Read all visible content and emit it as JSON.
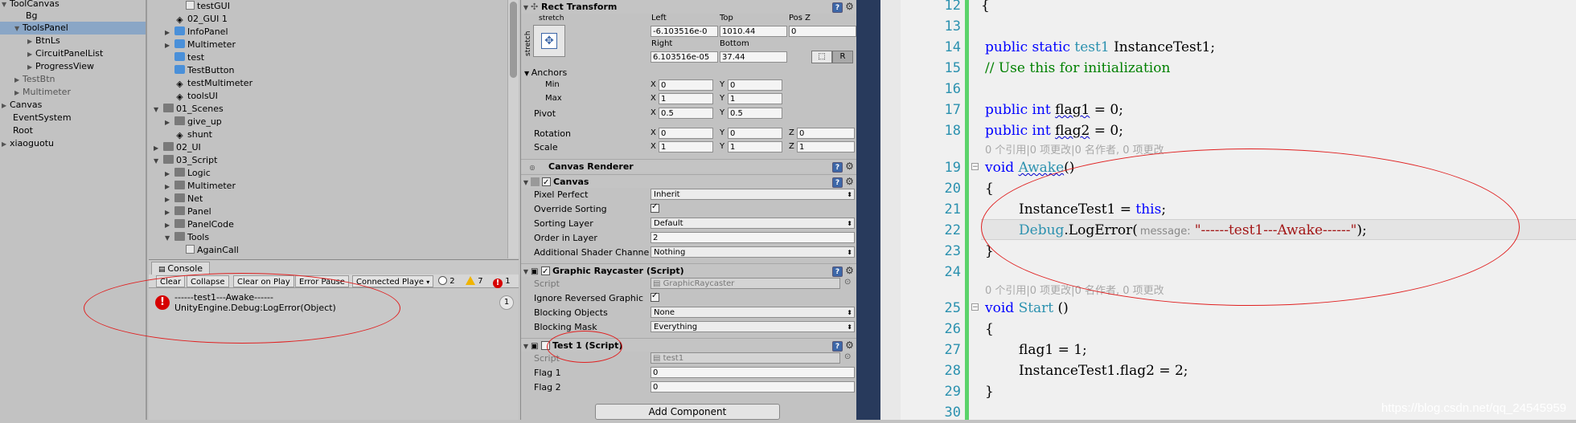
{
  "hierarchy": {
    "items": [
      {
        "label": "ToolCanvas",
        "expanded": "▼"
      },
      {
        "label": "Bg"
      },
      {
        "label": "ToolsPanel",
        "expanded": "▼"
      },
      {
        "label": "BtnLs",
        "expanded": "▶"
      },
      {
        "label": "CircuitPanelList",
        "expanded": "▶"
      },
      {
        "label": "ProgressView",
        "expanded": "▶"
      },
      {
        "label": "TestBtn",
        "expanded": "▶"
      },
      {
        "label": "Multimeter",
        "expanded": "▶"
      },
      {
        "label": "Canvas",
        "expanded": "▶"
      },
      {
        "label": "EventSystem"
      },
      {
        "label": "Root"
      },
      {
        "label": "xiaoguotu",
        "expanded": "▶"
      }
    ]
  },
  "project": {
    "items": [
      {
        "label": "testGUI"
      },
      {
        "label": "02_GUI 1"
      },
      {
        "label": "InfoPanel",
        "expanded": "▶"
      },
      {
        "label": "Multimeter",
        "expanded": "▶"
      },
      {
        "label": "test"
      },
      {
        "label": "TestButton"
      },
      {
        "label": "testMultimeter"
      },
      {
        "label": "toolsUI"
      },
      {
        "label": "01_Scenes",
        "expanded": "▼"
      },
      {
        "label": "give_up",
        "expanded": "▶"
      },
      {
        "label": "shunt"
      },
      {
        "label": "02_UI",
        "expanded": "▶"
      },
      {
        "label": "03_Script",
        "expanded": "▼"
      },
      {
        "label": "Logic",
        "expanded": "▶"
      },
      {
        "label": "Multimeter",
        "expanded": "▶"
      },
      {
        "label": "Net",
        "expanded": "▶"
      },
      {
        "label": "Panel",
        "expanded": "▶"
      },
      {
        "label": "PanelCode",
        "expanded": "▶"
      },
      {
        "label": "Tools",
        "expanded": "▼"
      },
      {
        "label": "AgainCall"
      }
    ]
  },
  "console": {
    "tab": "Console",
    "buttons": {
      "clear": "Clear",
      "collapse": "Collapse",
      "clear_on_play": "Clear on Play",
      "error_pause": "Error Pause",
      "connected": "Connected Playe"
    },
    "counts": {
      "info": "2",
      "warn": "7",
      "error": "1"
    },
    "entry": {
      "line1": "------test1---Awake------",
      "line2": "UnityEngine.Debug:LogError(Object)",
      "count": "1"
    }
  },
  "inspector": {
    "rect": {
      "title": "Rect Transform",
      "stretch_top": "stretch",
      "stretch_side": "stretch",
      "hdr_left": "Left",
      "hdr_top": "Top",
      "hdr_posz": "Pos Z",
      "left": "-6.103516e-0",
      "top": "1010.44",
      "posz": "0",
      "hdr_right": "Right",
      "hdr_bottom": "Bottom",
      "right": "6.103516e-05",
      "bottom": "37.44",
      "r_label": "R",
      "anchors": "Anchors",
      "min": "Min",
      "max": "Max",
      "min_x": "0",
      "min_y": "0",
      "max_x": "1",
      "max_y": "1",
      "pivot": "Pivot",
      "pivot_x": "0.5",
      "pivot_y": "0.5",
      "rotation": "Rotation",
      "rot_x": "0",
      "rot_y": "0",
      "rot_z": "0",
      "scale": "Scale",
      "scale_x": "1",
      "scale_y": "1",
      "scale_z": "1",
      "ax_x": "X",
      "ax_y": "Y",
      "ax_z": "Z"
    },
    "canvas_renderer": "Canvas Renderer",
    "canvas": {
      "title": "Canvas",
      "pixel_perfect": "Pixel Perfect",
      "pixel_perfect_val": "Inherit",
      "override_sorting": "Override Sorting",
      "sorting_layer": "Sorting Layer",
      "sorting_layer_val": "Default",
      "order_in_layer": "Order in Layer",
      "order_val": "2",
      "shader_channels": "Additional Shader Channe",
      "shader_val": "Nothing"
    },
    "raycaster": {
      "title": "Graphic Raycaster (Script)",
      "script": "Script",
      "script_val": "GraphicRaycaster",
      "ignore": "Ignore Reversed Graphic",
      "blocking_objects": "Blocking Objects",
      "blocking_objects_val": "None",
      "blocking_mask": "Blocking Mask",
      "blocking_mask_val": "Everything"
    },
    "test1": {
      "title": "Test 1 (Script)",
      "script": "Script",
      "script_val": "test1",
      "flag1": "Flag 1",
      "flag1_val": "0",
      "flag2": "Flag 2",
      "flag2_val": "0"
    },
    "add_component": "Add Component"
  },
  "code": {
    "line_numbers": [
      "12",
      "13",
      "14",
      "15",
      "16",
      "17",
      "18",
      "19",
      "20",
      "21",
      "22",
      "23",
      "24",
      "25",
      "26",
      "27",
      "28",
      "29",
      "30"
    ],
    "l12": "{",
    "l14_kw": "public static ",
    "l14_ty": "test1",
    "l14_rest": " InstanceTest1;",
    "l15": "// Use this for initialization",
    "l17_kw": "public int ",
    "l17_id": "flag1",
    "l17_rest": " = 0;",
    "l18_kw": "public int ",
    "l18_id": "flag2",
    "l18_rest": " = 0;",
    "lens1": "0 个引用|0 项更改|0 名作者, 0 项更改",
    "l19_kw": "void ",
    "l19_id": "Awake",
    "l19_rest": "()",
    "l20": "{",
    "l21_a": "InstanceTest1 = ",
    "l21_kw": "this",
    "l21_b": ";",
    "l22_ty": "Debug",
    "l22_a": ".LogError(",
    "l22_hint": "message:",
    "l22_str": "\"------test1---Awake------\"",
    "l22_b": ");",
    "l23": "}",
    "lens2": "0 个引用|0 项更改|0 名作者, 0 项更改",
    "l25_kw": "void ",
    "l25_id": "Start",
    "l25_rest": " ()",
    "l26": "{",
    "l27": "flag1 = 1;",
    "l28": "InstanceTest1.flag2 = 2;",
    "l29": "}"
  },
  "watermark": "https://blog.csdn.net/qq_24545959",
  "colors": {
    "annotation": "#e02020",
    "selection": "#8aa6c6",
    "keyword": "#0000ff",
    "type": "#2b91af",
    "comment": "#008000",
    "string": "#a31515"
  }
}
